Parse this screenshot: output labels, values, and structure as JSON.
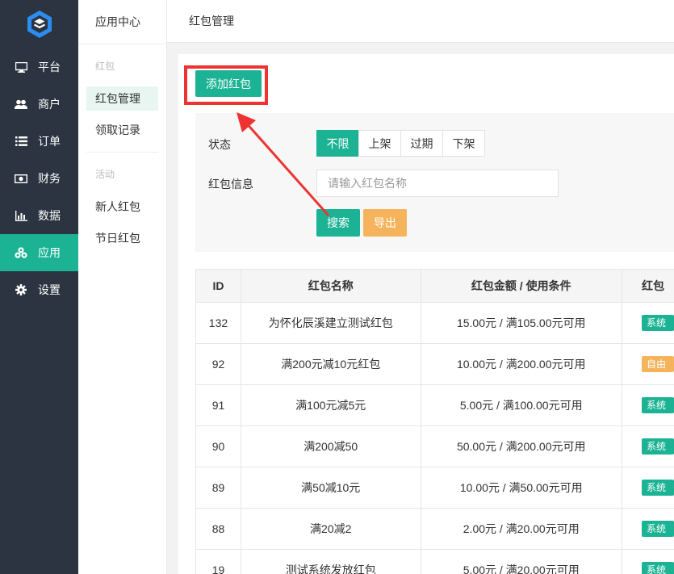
{
  "sidebar": {
    "items": [
      {
        "label": "平台",
        "icon": "monitor-icon"
      },
      {
        "label": "商户",
        "icon": "users-icon"
      },
      {
        "label": "订单",
        "icon": "list-icon"
      },
      {
        "label": "财务",
        "icon": "money-icon"
      },
      {
        "label": "数据",
        "icon": "bar-chart-icon"
      },
      {
        "label": "应用",
        "icon": "apps-icon"
      },
      {
        "label": "设置",
        "icon": "gear-icon"
      }
    ]
  },
  "submenu": {
    "title": "应用中心",
    "group1": "红包",
    "group1_items": [
      "红包管理",
      "领取记录"
    ],
    "group2": "活动",
    "group2_items": [
      "新人红包",
      "节日红包"
    ]
  },
  "topbar": {
    "title": "红包管理"
  },
  "toolbar": {
    "add_label": "添加红包"
  },
  "filter": {
    "status_label": "状态",
    "status_options": [
      "不限",
      "上架",
      "过期",
      "下架"
    ],
    "info_label": "红包信息",
    "info_placeholder": "请输入红包名称",
    "search_label": "搜索",
    "export_label": "导出"
  },
  "table": {
    "headers": [
      "ID",
      "红包名称",
      "红包金额 / 使用条件",
      "红包"
    ],
    "rows": [
      {
        "id": "132",
        "name": "为怀化辰溪建立测试红包",
        "amount": "15.00元 / 满105.00元可用",
        "badge": "系统",
        "badge_color": "#1bb394"
      },
      {
        "id": "92",
        "name": "满200元减10元红包",
        "amount": "10.00元 / 满200.00元可用",
        "badge": "自由",
        "badge_color": "#f5b45c"
      },
      {
        "id": "91",
        "name": "满100元减5元",
        "amount": "5.00元 / 满100.00元可用",
        "badge": "系统",
        "badge_color": "#1bb394"
      },
      {
        "id": "90",
        "name": "满200减50",
        "amount": "50.00元 / 满200.00元可用",
        "badge": "系统",
        "badge_color": "#1bb394"
      },
      {
        "id": "89",
        "name": "满50减10元",
        "amount": "10.00元 / 满50.00元可用",
        "badge": "系统",
        "badge_color": "#1bb394"
      },
      {
        "id": "88",
        "name": "满20减2",
        "amount": "2.00元 / 满20.00元可用",
        "badge": "系统",
        "badge_color": "#1bb394"
      },
      {
        "id": "19",
        "name": "测试系统发放红包",
        "amount": "5.00元 / 满20.00元可用",
        "badge": "系统",
        "badge_color": "#1bb394"
      }
    ]
  },
  "colors": {
    "accent": "#1bb394",
    "warning": "#f5b45c",
    "annotation": "#ee3333",
    "sidebar_bg": "#2b3440"
  }
}
